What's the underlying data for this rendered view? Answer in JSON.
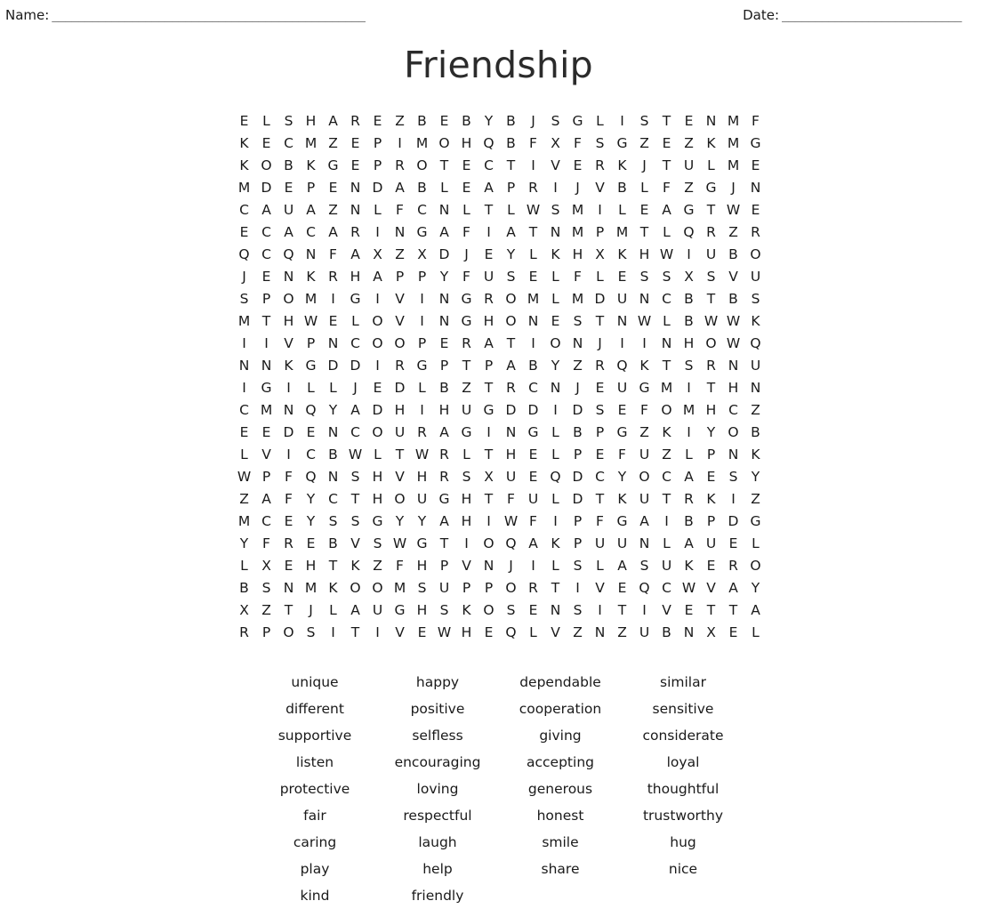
{
  "header": {
    "name_label": "Name:",
    "name_rule": "_______________________________________________",
    "date_label": "Date:",
    "date_rule": "___________________________"
  },
  "title": "Friendship",
  "puzzle": {
    "columns": 24,
    "rows": 24,
    "grid": [
      [
        "E",
        "L",
        "S",
        "H",
        "A",
        "R",
        "E",
        "Z",
        "B",
        "E",
        "B",
        "Y",
        "B",
        "J",
        "S",
        "G",
        "L",
        "I",
        "S",
        "T",
        "E",
        "N",
        "M",
        "F"
      ],
      [
        "K",
        "E",
        "C",
        "M",
        "Z",
        "E",
        "P",
        "I",
        "M",
        "O",
        "H",
        "Q",
        "B",
        "F",
        "X",
        "F",
        "S",
        "G",
        "Z",
        "E",
        "Z",
        "K",
        "M",
        "G"
      ],
      [
        "K",
        "O",
        "B",
        "K",
        "G",
        "E",
        "P",
        "R",
        "O",
        "T",
        "E",
        "C",
        "T",
        "I",
        "V",
        "E",
        "R",
        "K",
        "J",
        "T",
        "U",
        "L",
        "M",
        "E"
      ],
      [
        "M",
        "D",
        "E",
        "P",
        "E",
        "N",
        "D",
        "A",
        "B",
        "L",
        "E",
        "A",
        "P",
        "R",
        "I",
        "J",
        "V",
        "B",
        "L",
        "F",
        "Z",
        "G",
        "J",
        "N"
      ],
      [
        "C",
        "A",
        "U",
        "A",
        "Z",
        "N",
        "L",
        "F",
        "C",
        "N",
        "L",
        "T",
        "L",
        "W",
        "S",
        "M",
        "I",
        "L",
        "E",
        "A",
        "G",
        "T",
        "W",
        "E"
      ],
      [
        "E",
        "C",
        "A",
        "C",
        "A",
        "R",
        "I",
        "N",
        "G",
        "A",
        "F",
        "I",
        "A",
        "T",
        "N",
        "M",
        "P",
        "M",
        "T",
        "L",
        "Q",
        "R",
        "Z",
        "R"
      ],
      [
        "Q",
        "C",
        "Q",
        "N",
        "F",
        "A",
        "X",
        "Z",
        "X",
        "D",
        "J",
        "E",
        "Y",
        "L",
        "K",
        "H",
        "X",
        "K",
        "H",
        "W",
        "I",
        "U",
        "B",
        "O"
      ],
      [
        "J",
        "E",
        "N",
        "K",
        "R",
        "H",
        "A",
        "P",
        "P",
        "Y",
        "F",
        "U",
        "S",
        "E",
        "L",
        "F",
        "L",
        "E",
        "S",
        "S",
        "X",
        "S",
        "V",
        "U"
      ],
      [
        "S",
        "P",
        "O",
        "M",
        "I",
        "G",
        "I",
        "V",
        "I",
        "N",
        "G",
        "R",
        "O",
        "M",
        "L",
        "M",
        "D",
        "U",
        "N",
        "C",
        "B",
        "T",
        "B",
        "S"
      ],
      [
        "M",
        "T",
        "H",
        "W",
        "E",
        "L",
        "O",
        "V",
        "I",
        "N",
        "G",
        "H",
        "O",
        "N",
        "E",
        "S",
        "T",
        "N",
        "W",
        "L",
        "B",
        "W",
        "W",
        "K"
      ],
      [
        "I",
        "I",
        "V",
        "P",
        "N",
        "C",
        "O",
        "O",
        "P",
        "E",
        "R",
        "A",
        "T",
        "I",
        "O",
        "N",
        "J",
        "I",
        "I",
        "N",
        "H",
        "O",
        "W",
        "Q"
      ],
      [
        "N",
        "N",
        "K",
        "G",
        "D",
        "D",
        "I",
        "R",
        "G",
        "P",
        "T",
        "P",
        "A",
        "B",
        "Y",
        "Z",
        "R",
        "Q",
        "K",
        "T",
        "S",
        "R",
        "N",
        "U"
      ],
      [
        "I",
        "G",
        "I",
        "L",
        "L",
        "J",
        "E",
        "D",
        "L",
        "B",
        "Z",
        "T",
        "R",
        "C",
        "N",
        "J",
        "E",
        "U",
        "G",
        "M",
        "I",
        "T",
        "H",
        "N"
      ],
      [
        "C",
        "M",
        "N",
        "Q",
        "Y",
        "A",
        "D",
        "H",
        "I",
        "H",
        "U",
        "G",
        "D",
        "D",
        "I",
        "D",
        "S",
        "E",
        "F",
        "O",
        "M",
        "H",
        "C",
        "Z"
      ],
      [
        "E",
        "E",
        "D",
        "E",
        "N",
        "C",
        "O",
        "U",
        "R",
        "A",
        "G",
        "I",
        "N",
        "G",
        "L",
        "B",
        "P",
        "G",
        "Z",
        "K",
        "I",
        "Y",
        "O",
        "B"
      ],
      [
        "L",
        "V",
        "I",
        "C",
        "B",
        "W",
        "L",
        "T",
        "W",
        "R",
        "L",
        "T",
        "H",
        "E",
        "L",
        "P",
        "E",
        "F",
        "U",
        "Z",
        "L",
        "P",
        "N",
        "K"
      ],
      [
        "W",
        "P",
        "F",
        "Q",
        "N",
        "S",
        "H",
        "V",
        "H",
        "R",
        "S",
        "X",
        "U",
        "E",
        "Q",
        "D",
        "C",
        "Y",
        "O",
        "C",
        "A",
        "E",
        "S",
        "Y"
      ],
      [
        "Z",
        "A",
        "F",
        "Y",
        "C",
        "T",
        "H",
        "O",
        "U",
        "G",
        "H",
        "T",
        "F",
        "U",
        "L",
        "D",
        "T",
        "K",
        "U",
        "T",
        "R",
        "K",
        "I",
        "Z"
      ],
      [
        "M",
        "C",
        "E",
        "Y",
        "S",
        "S",
        "G",
        "Y",
        "Y",
        "A",
        "H",
        "I",
        "W",
        "F",
        "I",
        "P",
        "F",
        "G",
        "A",
        "I",
        "B",
        "P",
        "D",
        "G"
      ],
      [
        "Y",
        "F",
        "R",
        "E",
        "B",
        "V",
        "S",
        "W",
        "G",
        "T",
        "I",
        "O",
        "Q",
        "A",
        "K",
        "P",
        "U",
        "U",
        "N",
        "L",
        "A",
        "U",
        "E",
        "L"
      ],
      [
        "L",
        "X",
        "E",
        "H",
        "T",
        "K",
        "Z",
        "F",
        "H",
        "P",
        "V",
        "N",
        "J",
        "I",
        "L",
        "S",
        "L",
        "A",
        "S",
        "U",
        "K",
        "E",
        "R",
        "O"
      ],
      [
        "B",
        "S",
        "N",
        "M",
        "K",
        "O",
        "O",
        "M",
        "S",
        "U",
        "P",
        "P",
        "O",
        "R",
        "T",
        "I",
        "V",
        "E",
        "Q",
        "C",
        "W",
        "V",
        "A",
        "Y"
      ],
      [
        "X",
        "Z",
        "T",
        "J",
        "L",
        "A",
        "U",
        "G",
        "H",
        "S",
        "K",
        "O",
        "S",
        "E",
        "N",
        "S",
        "I",
        "T",
        "I",
        "V",
        "E",
        "T",
        "T",
        "A"
      ],
      [
        "R",
        "P",
        "O",
        "S",
        "I",
        "T",
        "I",
        "V",
        "E",
        "W",
        "H",
        "E",
        "Q",
        "L",
        "V",
        "Z",
        "N",
        "Z",
        "U",
        "B",
        "N",
        "X",
        "E",
        "L"
      ]
    ]
  },
  "wordlist": {
    "columns": [
      [
        "unique",
        "different",
        "supportive",
        "listen",
        "protective",
        "fair",
        "caring",
        "play",
        "kind"
      ],
      [
        "happy",
        "positive",
        "selfless",
        "encouraging",
        "loving",
        "respectful",
        "laugh",
        "help",
        "friendly"
      ],
      [
        "dependable",
        "cooperation",
        "giving",
        "accepting",
        "generous",
        "honest",
        "smile",
        "share",
        ""
      ],
      [
        "similar",
        "sensitive",
        "considerate",
        "loyal",
        "thoughtful",
        "trustworthy",
        "hug",
        "nice",
        ""
      ]
    ]
  }
}
